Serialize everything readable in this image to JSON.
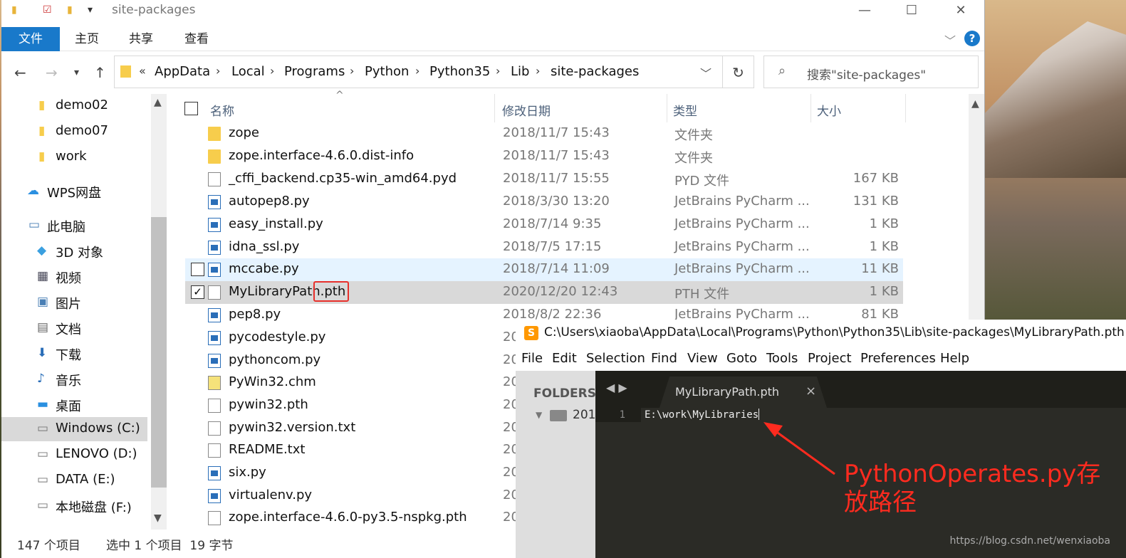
{
  "window": {
    "title": "site-packages",
    "minimize": "—",
    "maximize": "☐",
    "close": "✕"
  },
  "ribbon": {
    "tabs": [
      "文件",
      "主页",
      "共享",
      "查看"
    ],
    "help": "?"
  },
  "address": {
    "prefix": "«",
    "crumbs": [
      "AppData",
      "Local",
      "Programs",
      "Python",
      "Python35",
      "Lib",
      "site-packages"
    ]
  },
  "search": {
    "placeholder": "搜索\"site-packages\""
  },
  "sidebar": {
    "items": [
      {
        "label": "demo02",
        "icon": "folder-icon"
      },
      {
        "label": "demo07",
        "icon": "folder-icon"
      },
      {
        "label": "work",
        "icon": "folder-icon"
      },
      {
        "label": "WPS网盘",
        "icon": "cloud-icon"
      },
      {
        "label": "此电脑",
        "icon": "computer-icon"
      },
      {
        "label": "3D 对象",
        "icon": "cube-icon"
      },
      {
        "label": "视频",
        "icon": "video-icon"
      },
      {
        "label": "图片",
        "icon": "picture-icon"
      },
      {
        "label": "文档",
        "icon": "document-icon"
      },
      {
        "label": "下载",
        "icon": "download-icon"
      },
      {
        "label": "音乐",
        "icon": "music-icon"
      },
      {
        "label": "桌面",
        "icon": "desktop-icon"
      },
      {
        "label": "Windows (C:)",
        "icon": "drive-icon"
      },
      {
        "label": "LENOVO (D:)",
        "icon": "drive-icon"
      },
      {
        "label": "DATA (E:)",
        "icon": "drive-icon"
      },
      {
        "label": "本地磁盘 (F:)",
        "icon": "drive-icon"
      }
    ]
  },
  "columns": {
    "name": "名称",
    "date": "修改日期",
    "type": "类型",
    "size": "大小"
  },
  "files": [
    {
      "name": "zope",
      "date": "2018/11/7 15:43",
      "type": "文件夹",
      "size": "",
      "icon": "folder"
    },
    {
      "name": "zope.interface-4.6.0.dist-info",
      "date": "2018/11/7 15:43",
      "type": "文件夹",
      "size": "",
      "icon": "folder"
    },
    {
      "name": "_cffi_backend.cp35-win_amd64.pyd",
      "date": "2018/11/7 15:55",
      "type": "PYD 文件",
      "size": "167 KB",
      "icon": "doc"
    },
    {
      "name": "autopep8.py",
      "date": "2018/3/30 13:20",
      "type": "JetBrains PyCharm ...",
      "size": "131 KB",
      "icon": "py"
    },
    {
      "name": "easy_install.py",
      "date": "2018/7/14 9:35",
      "type": "JetBrains PyCharm ...",
      "size": "1 KB",
      "icon": "py"
    },
    {
      "name": "idna_ssl.py",
      "date": "2018/7/5 17:15",
      "type": "JetBrains PyCharm ...",
      "size": "1 KB",
      "icon": "py"
    },
    {
      "name": "mccabe.py",
      "date": "2018/7/14 11:09",
      "type": "JetBrains PyCharm ...",
      "size": "11 KB",
      "icon": "py"
    },
    {
      "name": "MyLibraryPath.pth",
      "date": "2020/12/20 12:43",
      "type": "PTH 文件",
      "size": "1 KB",
      "icon": "doc"
    },
    {
      "name": "pep8.py",
      "date": "2018/8/2 22:36",
      "type": "JetBrains PyCharm ...",
      "size": "81 KB",
      "icon": "py"
    },
    {
      "name": "pycodestyle.py",
      "date": "20",
      "type": "",
      "size": "",
      "icon": "py"
    },
    {
      "name": "pythoncom.py",
      "date": "20",
      "type": "",
      "size": "",
      "icon": "py"
    },
    {
      "name": "PyWin32.chm",
      "date": "20",
      "type": "",
      "size": "",
      "icon": "chm"
    },
    {
      "name": "pywin32.pth",
      "date": "20",
      "type": "",
      "size": "",
      "icon": "doc"
    },
    {
      "name": "pywin32.version.txt",
      "date": "20",
      "type": "",
      "size": "",
      "icon": "txt"
    },
    {
      "name": "README.txt",
      "date": "20",
      "type": "",
      "size": "",
      "icon": "txt"
    },
    {
      "name": "six.py",
      "date": "20",
      "type": "",
      "size": "",
      "icon": "py"
    },
    {
      "name": "virtualenv.py",
      "date": "20",
      "type": "",
      "size": "",
      "icon": "py"
    },
    {
      "name": "zope.interface-4.6.0-py3.5-nspkg.pth",
      "date": "20",
      "type": "",
      "size": "",
      "icon": "doc"
    }
  ],
  "status": {
    "count": "147 个项目",
    "selection": "选中 1 个项目  19 字节"
  },
  "editor": {
    "title": "C:\\Users\\xiaoba\\AppData\\Local\\Programs\\Python\\Python35\\Lib\\site-packages\\MyLibraryPath.pth",
    "menu": [
      "File",
      "Edit",
      "Selection",
      "Find",
      "View",
      "Goto",
      "Tools",
      "Project",
      "Preferences",
      "Help"
    ],
    "sidebar_header": "FOLDERS",
    "folder": "201",
    "tab": "MyLibraryPath.pth",
    "line_number": "1",
    "code": "E:\\work\\MyLibraries"
  },
  "annotation": "PythonOperates.py存放路径",
  "watermark": "https://blog.csdn.net/wenxiaoba"
}
